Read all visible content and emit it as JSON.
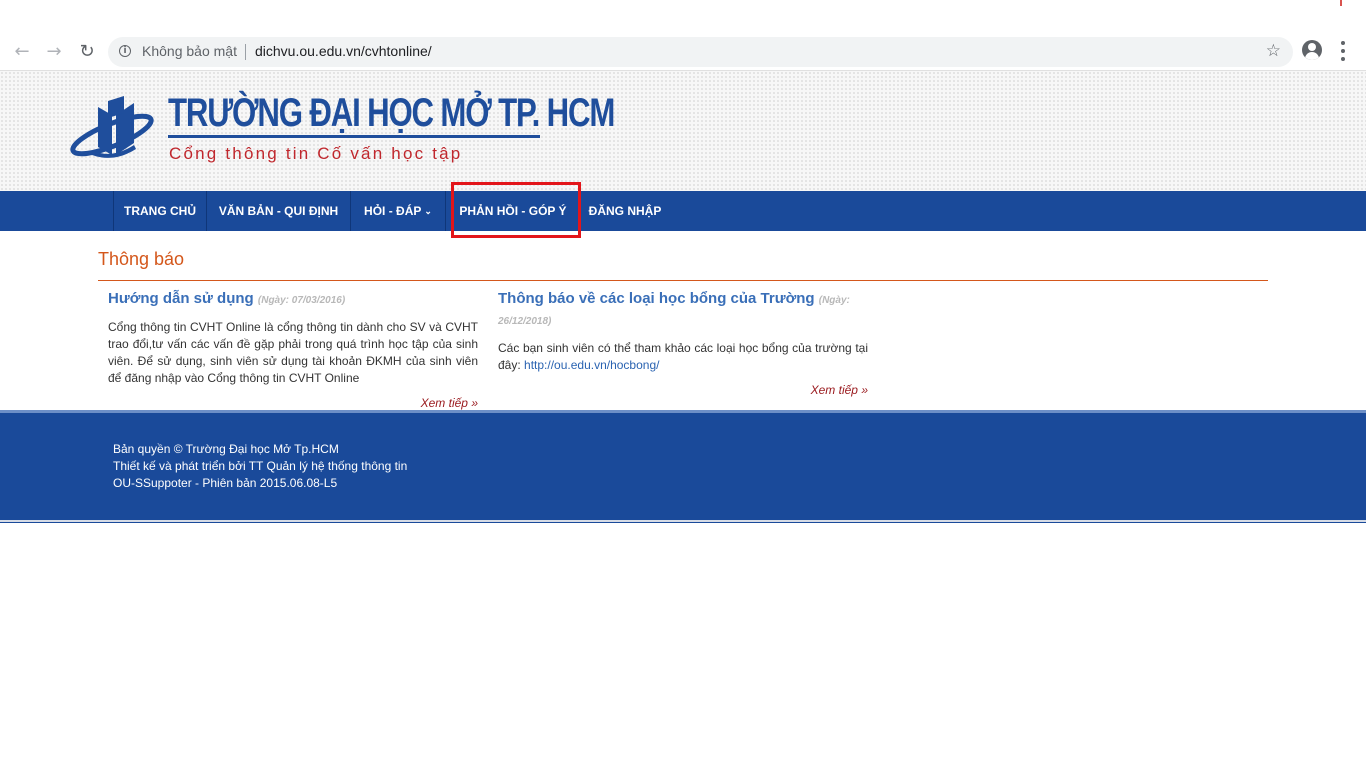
{
  "browser": {
    "security_label": "Không bảo mật",
    "url": "dichvu.ou.edu.vn/cvhtonline/",
    "icons": {
      "back": "arrow-left",
      "forward": "arrow-right",
      "reload": "reload",
      "info": "info-circle",
      "bookmark": "star",
      "profile": "account-circle",
      "menu": "vertical-dots"
    }
  },
  "header": {
    "title": "TRƯỜNG ĐẠI HỌC MỞ TP. HCM",
    "subtitle": "Cổng thông tin Cố vấn học tập",
    "colors": {
      "title": "#1f4e9c",
      "subtitle": "#c0272d"
    }
  },
  "nav": {
    "items": [
      {
        "label": "TRANG CHỦ"
      },
      {
        "label": "VĂN BẢN - QUI ĐỊNH"
      },
      {
        "label": "HỎI - ĐÁP",
        "has_dropdown": true
      },
      {
        "label": "PHẢN HỒI - GÓP Ý",
        "highlighted": true
      },
      {
        "label": "ĐĂNG NHẬP"
      }
    ],
    "colors": {
      "background": "#1a4a9a",
      "highlight_border": "#e3151a"
    }
  },
  "main": {
    "section_title": "Thông báo",
    "notices": [
      {
        "title": "Hướng dẫn sử dụng",
        "date": "(Ngày: 07/03/2016)",
        "body": "Cổng thông tin CVHT Online là cổng thông tin dành cho SV và CVHT trao đổi,tư vấn các vấn đề gặp phải trong quá trình học tập của sinh viên. Để sử dụng, sinh viên sử dụng tài khoản ĐKMH của sinh viên để đăng nhập vào Cổng thông tin CVHT Online",
        "read_more": "Xem tiếp »"
      },
      {
        "title": "Thông báo về các loại học bổng của Trường",
        "date": "(Ngày: 26/12/2018)",
        "body": "Các bạn sinh viên có thể tham khảo các loại học bổng của trường tại đây: ",
        "link": "http://ou.edu.vn/hocbong/",
        "read_more": "Xem tiếp »"
      }
    ],
    "colors": {
      "section_title": "#d4571b",
      "notice_title": "#3a6fb8",
      "read_more": "#9b1c20"
    }
  },
  "footer": {
    "lines": [
      "Bản quyền © Trường Đại học Mở Tp.HCM",
      "Thiết kế và phát triển bởi TT Quản lý hệ thống thông tin",
      "OU-SSuppoter - Phiên bản 2015.06.08-L5"
    ],
    "colors": {
      "background": "#1a4a9a"
    }
  }
}
